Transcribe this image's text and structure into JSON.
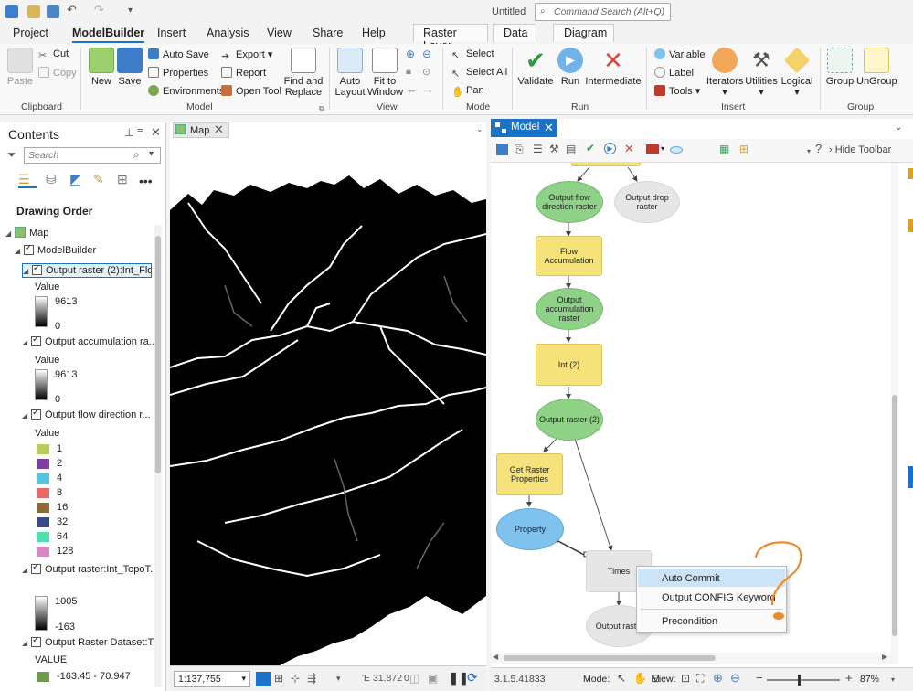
{
  "app": {
    "title": "Untitled",
    "command_search_placeholder": "Command Search (Alt+Q)"
  },
  "menu_tabs": [
    "Project",
    "ModelBuilder",
    "Insert",
    "Analysis",
    "View",
    "Share",
    "Help"
  ],
  "context_tabs": [
    "Raster Layer",
    "Data",
    "Diagram"
  ],
  "ribbon": {
    "clipboard": {
      "paste": "Paste",
      "cut": "Cut",
      "copy": "Copy",
      "label": "Clipboard"
    },
    "model": {
      "new": "New",
      "save": "Save",
      "auto_save": "Auto Save",
      "properties": "Properties",
      "environments": "Environments",
      "export": "Export",
      "report": "Report",
      "open_tool": "Open Tool",
      "find_replace_1": "Find and",
      "find_replace_2": "Replace",
      "label": "Model"
    },
    "view": {
      "auto_layout_1": "Auto",
      "auto_layout_2": "Layout",
      "fit_window_1": "Fit to",
      "fit_window_2": "Window",
      "label": "View"
    },
    "mode": {
      "select": "Select",
      "select_all": "Select All",
      "pan": "Pan",
      "label": "Mode"
    },
    "run": {
      "validate": "Validate",
      "run": "Run",
      "intermediate": "Intermediate",
      "label": "Run"
    },
    "insert": {
      "variable": "Variable",
      "label_btn": "Label",
      "tools": "Tools",
      "iterators": "Iterators",
      "utilities": "Utilities",
      "logical": "Logical",
      "label": "Insert"
    },
    "group": {
      "group": "Group",
      "ungroup": "UnGroup",
      "label": "Group"
    }
  },
  "contents": {
    "title": "Contents",
    "search_placeholder": "Search",
    "drawing_order": "Drawing Order",
    "map": "Map",
    "modelbuilder": "ModelBuilder",
    "layers": [
      {
        "name": "Output raster (2):Int_Flo...",
        "value_label": "Value",
        "max": "9613",
        "min": "0"
      },
      {
        "name": "Output accumulation ra...",
        "value_label": "Value",
        "max": "9613",
        "min": "0"
      },
      {
        "name": "Output flow direction r...",
        "value_label": "Value",
        "classes": [
          {
            "label": "1",
            "color": "#b6cf5a"
          },
          {
            "label": "2",
            "color": "#7b3fa1"
          },
          {
            "label": "4",
            "color": "#58c3de"
          },
          {
            "label": "8",
            "color": "#e66a6a"
          },
          {
            "label": "16",
            "color": "#8b6a3a"
          },
          {
            "label": "32",
            "color": "#3a4a86"
          },
          {
            "label": "64",
            "color": "#4fe0ae"
          },
          {
            "label": "128",
            "color": "#d487c4"
          }
        ]
      },
      {
        "name": "Output raster:Int_TopoT...",
        "max": "1005",
        "min": "-163"
      },
      {
        "name": "Output Raster Dataset:T...",
        "value_label": "VALUE",
        "first_class": "-163.45 - 70.947",
        "first_color": "#6b9c4b"
      }
    ]
  },
  "map": {
    "tab": "Map",
    "scale": "1:137,755",
    "coord": "'E 31.872",
    "zero": "0"
  },
  "model": {
    "tab": "Model",
    "hide_toolbar": "Hide Toolbar",
    "nodes": {
      "output_flow_direction": "Output flow direction raster",
      "output_drop": "Output drop raster",
      "flow_accumulation": "Flow Accumulation",
      "output_accumulation": "Output accumulation raster",
      "int2": "Int (2)",
      "output_raster2": "Output raster (2)",
      "get_raster_properties": "Get Raster Properties",
      "property": "Property",
      "times": "Times",
      "output_raster": "Output raster"
    },
    "context_menu": [
      "Auto Commit",
      "Output CONFIG Keyword",
      "Precondition"
    ],
    "version": "3.1.5.41833",
    "mode_label": "Mode:",
    "view_label": "View:",
    "zoom": "87%"
  },
  "colors": {
    "accent": "#1a73c8",
    "annotation": "#f08a24"
  }
}
